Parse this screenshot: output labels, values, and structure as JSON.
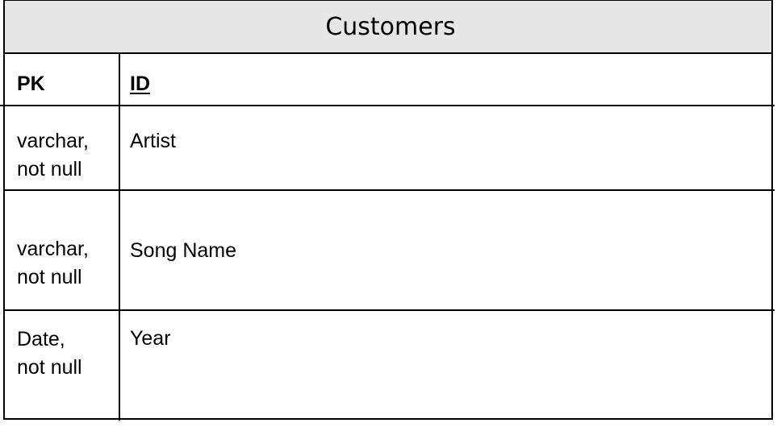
{
  "entity": {
    "title": "Customers",
    "header_color": "#e6e6e6",
    "key_row": {
      "key": "PK",
      "field": "ID"
    },
    "rows": [
      {
        "type": "varchar,\nnot null",
        "field": "Artist"
      },
      {
        "type": "varchar,\nnot null",
        "field": "Song Name"
      },
      {
        "type": "Date,\nnot null",
        "field": "Year"
      }
    ]
  }
}
